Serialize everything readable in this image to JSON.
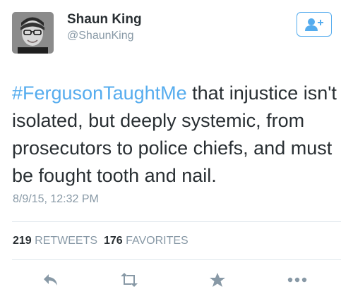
{
  "tweet": {
    "author_name": "Shaun King",
    "author_handle": "@ShaunKing",
    "hashtag": "#FergusonTaughtMe",
    "text": " that injustice isn't isolated, but deeply systemic, from prosecutors to police chiefs, and must be fought tooth and nail.",
    "timestamp": "8/9/15, 12:32 PM"
  },
  "stats": {
    "retweets_count": "219",
    "retweets_label": "RETWEETS",
    "favorites_count": "176",
    "favorites_label": "FAVORITES"
  },
  "actions": {
    "icons": [
      "reply-icon",
      "retweet-icon",
      "favorite-icon",
      "more-icon"
    ]
  },
  "colors": {
    "accent": "#55acee",
    "text": "#292f33",
    "muted": "#8899a6",
    "icon": "#8899a6"
  }
}
